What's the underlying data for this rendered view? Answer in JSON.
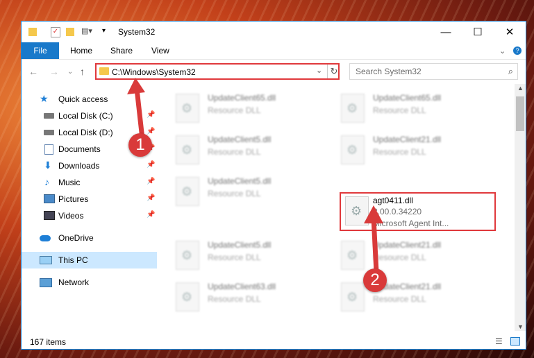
{
  "window": {
    "title": "System32",
    "minimize": "—",
    "maximize": "☐",
    "close": "✕"
  },
  "ribbon": {
    "tabs": [
      "File",
      "Home",
      "Share",
      "View"
    ],
    "help": "?"
  },
  "address": {
    "path": "C:\\Windows\\System32",
    "search_placeholder": "Search System32"
  },
  "nav": {
    "items": [
      {
        "label": "Quick access",
        "icon": "star-icon",
        "pinned": false
      },
      {
        "label": "Local Disk (C:)",
        "icon": "drive-icon",
        "pinned": true
      },
      {
        "label": "Local Disk (D:)",
        "icon": "drive-icon",
        "pinned": true
      },
      {
        "label": "Documents",
        "icon": "documents-icon",
        "pinned": true
      },
      {
        "label": "Downloads",
        "icon": "download-icon",
        "pinned": true
      },
      {
        "label": "Music",
        "icon": "music-icon",
        "pinned": true
      },
      {
        "label": "Pictures",
        "icon": "pictures-icon",
        "pinned": true
      },
      {
        "label": "Videos",
        "icon": "videos-icon",
        "pinned": true
      },
      {
        "label": "OneDrive",
        "icon": "cloud-icon",
        "pinned": false
      },
      {
        "label": "This PC",
        "icon": "computer-icon",
        "pinned": false,
        "selected": true
      },
      {
        "label": "Network",
        "icon": "network-icon",
        "pinned": false
      }
    ]
  },
  "files": [
    {
      "name": "UpdateClient65.dll",
      "line2": "Resource DLL"
    },
    {
      "name": "UpdateClient65.dll",
      "line2": "Resource DLL"
    },
    {
      "name": "UpdateClient5.dll",
      "line2": "Resource DLL"
    },
    {
      "name": "UpdateClient21.dll",
      "line2": "Resource DLL"
    },
    {
      "name": "UpdateClient5.dll",
      "line2": "Resource DLL"
    },
    {
      "name": "agt0411.dll",
      "line2": "2.00.0.34220",
      "line3": "Microsoft Agent Int...",
      "highlighted": true
    },
    {
      "name": "UpdateClient5.dll",
      "line2": "Resource DLL"
    },
    {
      "name": "UpdateClient21.dll",
      "line2": "Resource DLL"
    },
    {
      "name": "UpdateClient63.dll",
      "line2": "Resource DLL"
    },
    {
      "name": "UpdateClient21.dll",
      "line2": "Resource DLL"
    }
  ],
  "status": {
    "count": "167 items"
  },
  "annotations": {
    "badge1": "1",
    "badge2": "2"
  },
  "colors": {
    "accent": "#1979ca",
    "highlight": "#e0383b",
    "folder": "#f5c84c",
    "selected": "#cce8ff"
  }
}
